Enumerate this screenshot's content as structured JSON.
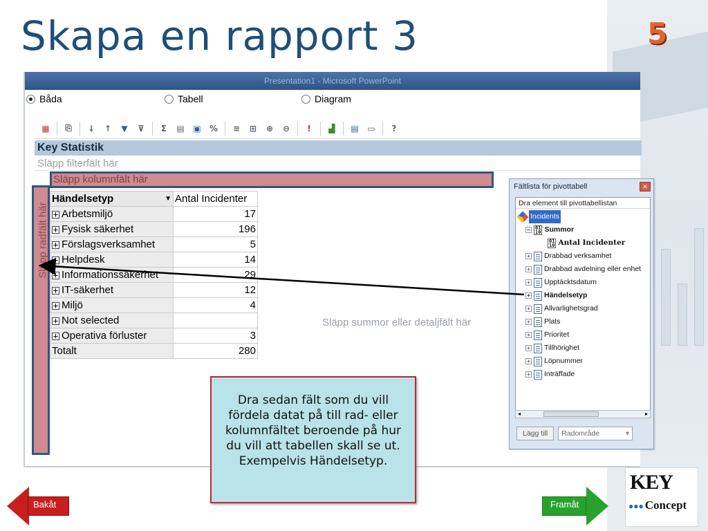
{
  "slide": {
    "title": "Skapa en rapport 3",
    "page_number": "5"
  },
  "window": {
    "titlebar_text": "Presentation1 - Microsoft PowerPoint",
    "radios": [
      {
        "label": "Båda",
        "selected": true
      },
      {
        "label": "Tabell",
        "selected": false
      },
      {
        "label": "Diagram",
        "selected": false
      }
    ],
    "toolbar_icons": [
      "pivot-icon",
      "copy-icon",
      "sort-asc-icon",
      "sort-desc-icon",
      "autofilter-icon",
      "filter-icon",
      "sum-icon",
      "subtotal-icon",
      "calculator-icon",
      "percent-icon",
      "field-icon",
      "field-settings-icon",
      "expand-icon",
      "collapse-icon",
      "alert-icon",
      "chart-icon",
      "export-icon",
      "properties-icon",
      "help-icon"
    ]
  },
  "pivot": {
    "report_title": "Key Statistik",
    "filter_drop": "Släpp filterfält här",
    "column_drop": "Släpp kolumnfält här",
    "row_drop": "Släpp radfält här",
    "values_drop": "Släpp summor eller detaljfält här",
    "header_field": "Händelsetyp",
    "header_measure": "Antal Incidenter",
    "rows": [
      {
        "label": "Arbetsmiljö",
        "value": "17"
      },
      {
        "label": "Fysisk säkerhet",
        "value": "196"
      },
      {
        "label": "Förslagsverksamhet",
        "value": "5"
      },
      {
        "label": "Helpdesk",
        "value": "14"
      },
      {
        "label": "Informationssäkerhet",
        "value": "29"
      },
      {
        "label": "IT-säkerhet",
        "value": "12"
      },
      {
        "label": "Miljö",
        "value": "4"
      },
      {
        "label": "Not selected",
        "value": ""
      },
      {
        "label": "Operativa förluster",
        "value": "3"
      }
    ],
    "total_label": "Totalt",
    "total_value": "280"
  },
  "fieldlist": {
    "title": "Fältlista för pivottabell",
    "subtitle": "Dra element till pivottabellistan",
    "root": "Incidents",
    "summor": "Summor",
    "measure": "Antal Incidenter",
    "fields": [
      {
        "label": "Drabbad verksamhet",
        "bold": false
      },
      {
        "label": "Drabbad avdelning eller enhet",
        "bold": false
      },
      {
        "label": "Upptäcktsdatum",
        "bold": false
      },
      {
        "label": "Händelsetyp",
        "bold": true
      },
      {
        "label": "Allvarlighetsgrad",
        "bold": false
      },
      {
        "label": "Plats",
        "bold": false
      },
      {
        "label": "Prioritet",
        "bold": false
      },
      {
        "label": "Tillhörighet",
        "bold": false
      },
      {
        "label": "Löpnummer",
        "bold": false
      },
      {
        "label": "Inträffade",
        "bold": false
      }
    ],
    "add_button": "Lägg till",
    "area_select": "Radområde"
  },
  "callout": {
    "text": "Dra sedan fält som du vill fördela datat på till rad- eller kolumnfältet beroende på hur du vill att tabellen skall se ut. Exempelvis Händelsetyp."
  },
  "nav": {
    "back": "Bakåt",
    "forward": "Framåt"
  },
  "logo": {
    "top": "KEY",
    "bottom": "Concept"
  },
  "colors": {
    "title": "#1f4e79",
    "drop_zone": "#cf8b90",
    "drop_border": "#32557f",
    "callout_bg": "#b9e3e8",
    "callout_border": "#c1272d",
    "back": "#c81e1e",
    "forward": "#27a22e"
  }
}
